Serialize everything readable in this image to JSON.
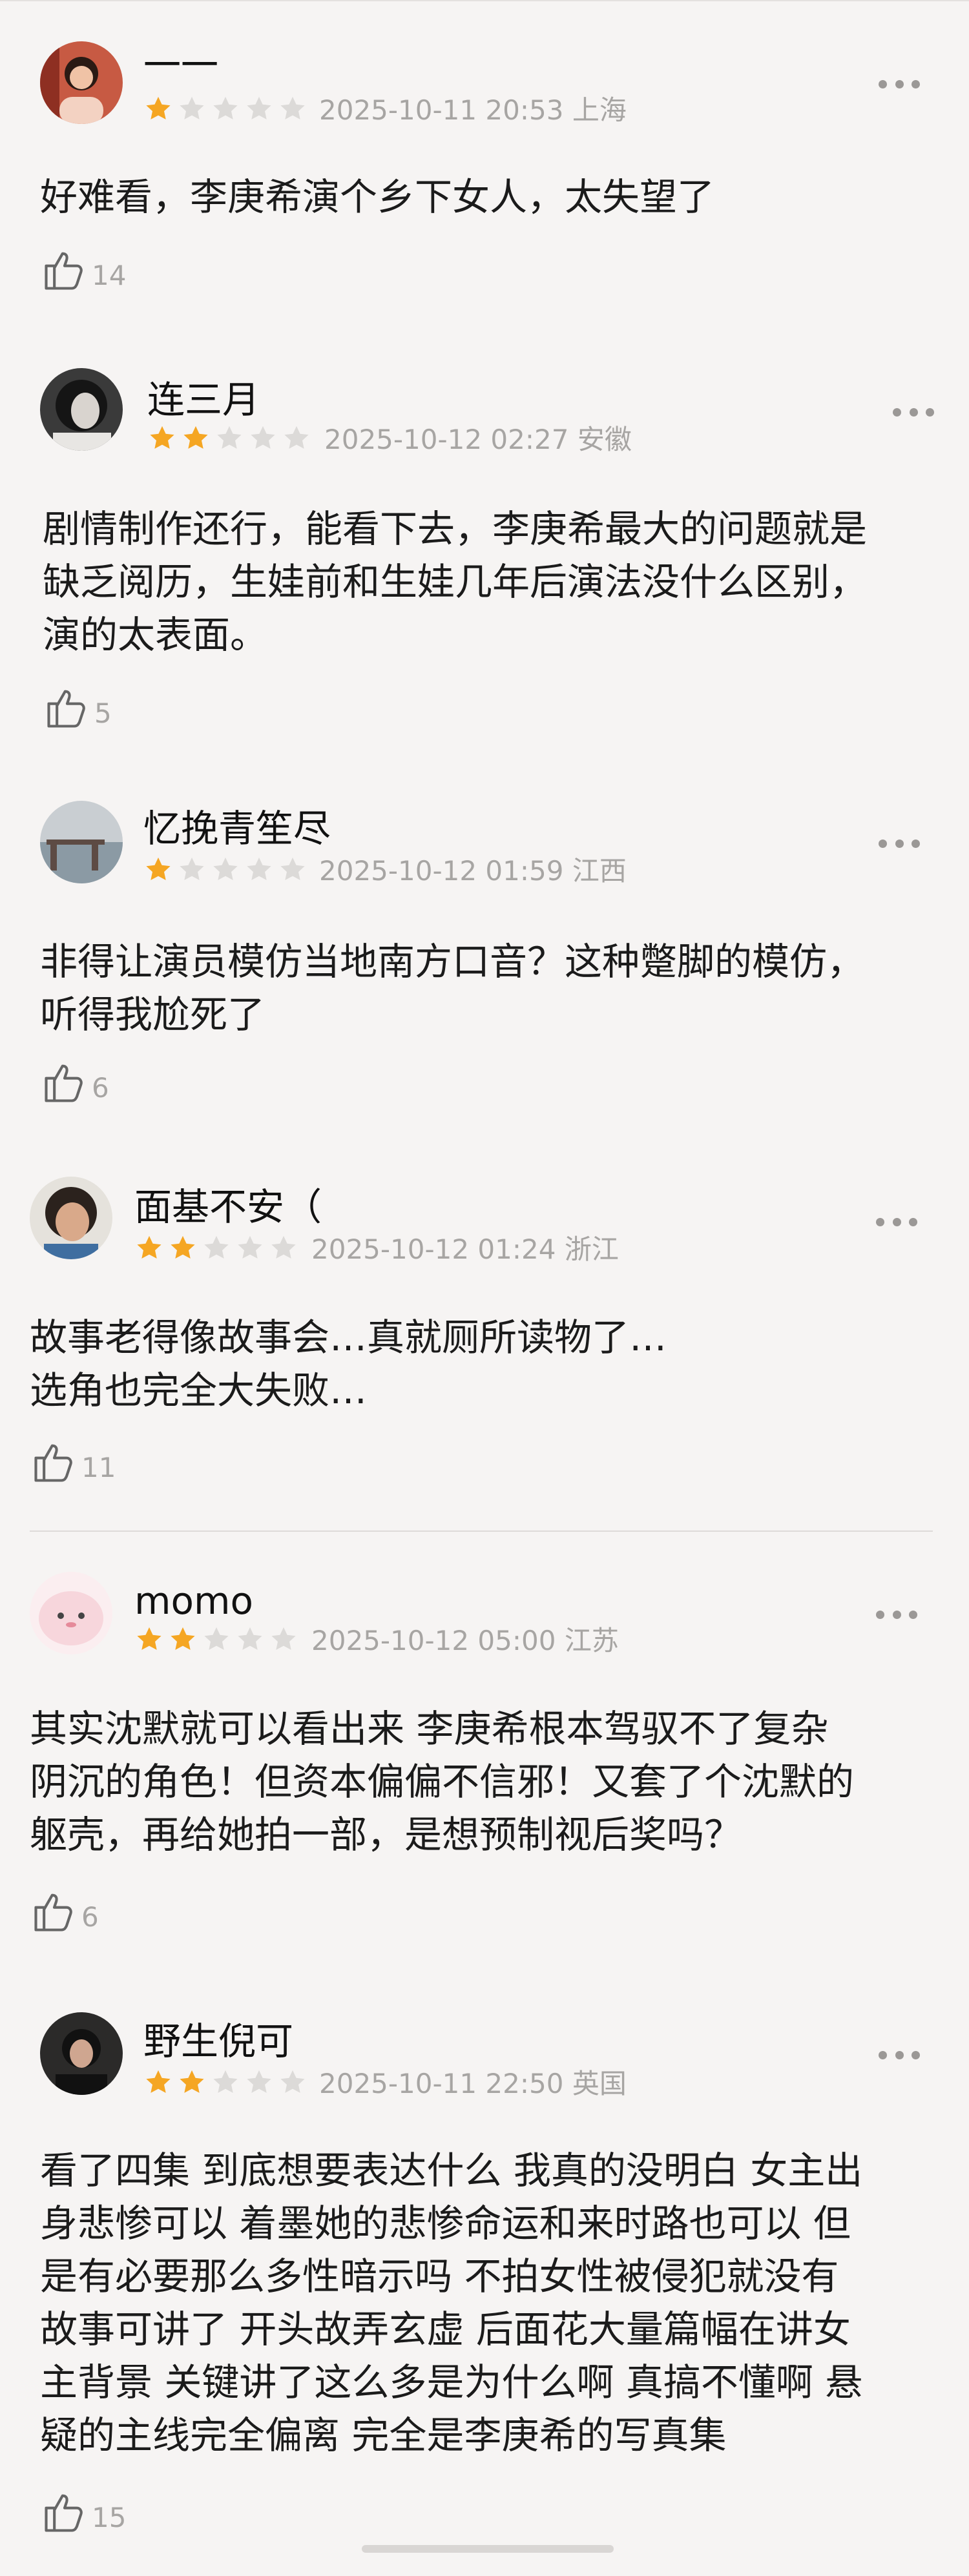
{
  "comments": [
    {
      "user": "一一",
      "rating": 1,
      "date": "2025-10-11 20:53",
      "location": "上海",
      "text": "好难看，李庚希演个乡下女人，太失望了",
      "likes": "14"
    },
    {
      "user": "连三月",
      "rating": 2,
      "date": "2025-10-12 02:27",
      "location": "安徽",
      "text": "剧情制作还行，能看下去，李庚希最大的问题就是\n缺乏阅历，生娃前和生娃几年后演法没什么区别，\n演的太表面。",
      "likes": "5"
    },
    {
      "user": "忆挽青笙尽",
      "rating": 1,
      "date": "2025-10-12 01:59",
      "location": "江西",
      "text": "非得让演员模仿当地南方口音？这种蹩脚的模仿，\n听得我尬死了",
      "likes": "6"
    },
    {
      "user": "面基不安（",
      "rating": 2,
      "date": "2025-10-12 01:24",
      "location": "浙江",
      "text": "故事老得像故事会…真就厕所读物了…\n选角也完全大失败…",
      "likes": "11"
    },
    {
      "user": "momo",
      "rating": 2,
      "date": "2025-10-12 05:00",
      "location": "江苏",
      "text": "其实沈默就可以看出来 李庚希根本驾驭不了复杂\n阴沉的角色！但资本偏偏不信邪！又套了个沈默的\n躯壳，再给她拍一部，是想预制视后奖吗？",
      "likes": "6"
    },
    {
      "user": "野生倪可",
      "rating": 2,
      "date": "2025-10-11 22:50",
      "location": "英国",
      "text": "看了四集 到底想要表达什么 我真的没明白 女主出\n身悲惨可以 着墨她的悲惨命运和来时路也可以 但\n是有必要那么多性暗示吗 不拍女性被侵犯就没有\n故事可讲了 开头故弄玄虚 后面花大量篇幅在讲女\n主背景 关键讲了这么多是为什么啊 真搞不懂啊 悬\n疑的主线完全偏离 完全是李庚希的写真集",
      "likes": "15"
    }
  ],
  "colors": {
    "background": "#f6f4f3",
    "star_filled": "#f5a623",
    "star_empty": "#dcdad8",
    "meta_text": "#a7a5a3",
    "divider": "#dedbd9"
  },
  "icons": {
    "like": "thumbs-up-icon",
    "more": "more-dots-icon",
    "star": "star-icon"
  }
}
